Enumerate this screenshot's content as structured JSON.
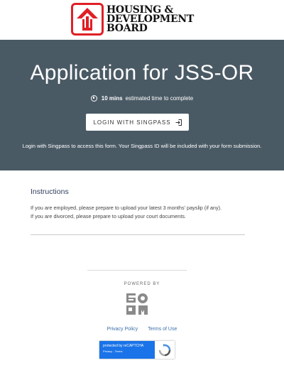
{
  "header": {
    "logo_lines": [
      "HOUSING &",
      "DEVELOPMENT",
      "BOARD"
    ]
  },
  "hero": {
    "title": "Application for JSS-OR",
    "eta_bold": "10 mins",
    "eta_rest": "estimated time to complete",
    "login_label": "LOGIN WITH SINGPASS",
    "note": "Login with Singpass to access this form. Your Singpass ID will be included with your form submission."
  },
  "instructions": {
    "title": "Instructions",
    "lines": [
      "If you are employed, please prepare to upload your latest 3 months' payslip (if any).",
      "If you are divorced, please prepare to upload your court documents."
    ]
  },
  "footer": {
    "powered_by": "POWERED BY",
    "links": [
      "Privacy Policy",
      "Terms of Use"
    ],
    "recaptcha_text": "protected by reCAPTCHA",
    "recaptcha_small": "Privacy - Terms"
  },
  "colors": {
    "hero_bg": "#4a5a65",
    "brand_red": "#e01f26",
    "link": "#3a6ea8"
  }
}
